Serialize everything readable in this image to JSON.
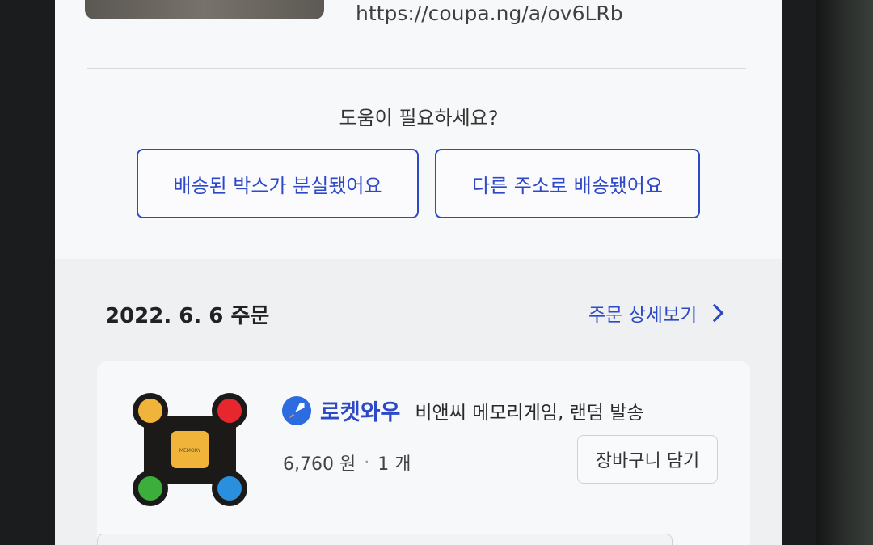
{
  "share": {
    "link": "https://coupa.ng/a/ov6LRb"
  },
  "help": {
    "title": "도움이 필요하세요?",
    "lost_box_label": "배송된 박스가 분실됐어요",
    "wrong_address_label": "다른 주소로 배송됐어요"
  },
  "order": {
    "date_label": "2022. 6. 6 주문",
    "detail_link": "주문 상세보기",
    "item": {
      "badge": "로켓와우",
      "name": "비앤씨 메모리게임, 랜덤 발송",
      "price": "6,760 원",
      "quantity": "1 개",
      "cart_button": "장바구니 담기",
      "image_text": "MEMORY"
    }
  },
  "colors": {
    "accent": "#2d49c8",
    "background": "#f4f5f6"
  }
}
